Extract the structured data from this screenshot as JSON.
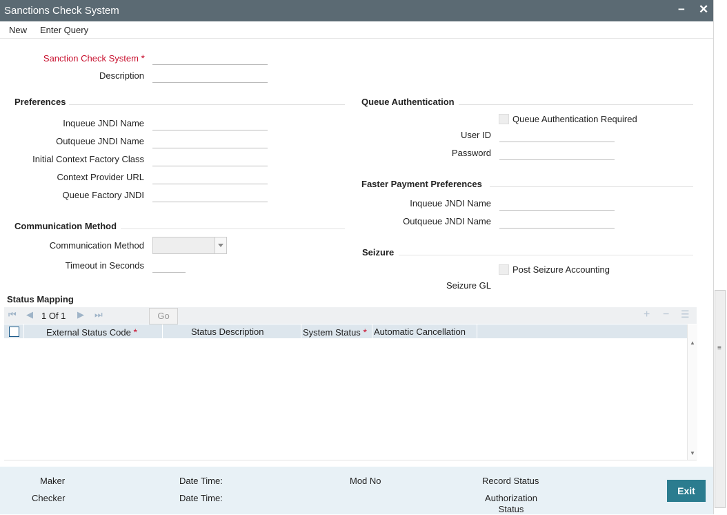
{
  "window": {
    "title": "Sanctions Check System",
    "minimize": "−",
    "close": "✕"
  },
  "menu": {
    "new": "New",
    "enter_query": "Enter Query"
  },
  "main": {
    "sanction_check_system": "Sanction Check System",
    "required_mark": "*",
    "description": "Description"
  },
  "preferences": {
    "title": "Preferences",
    "inqueue_jndi_name": "Inqueue JNDI Name",
    "outqueue_jndi_name": "Outqueue JNDI Name",
    "initial_context_factory_class": "Initial Context Factory Class",
    "context_provider_url": "Context Provider URL",
    "queue_factory_jndi": "Queue Factory JNDI"
  },
  "communication": {
    "title": "Communication Method",
    "method_label": "Communication Method",
    "timeout_label": "Timeout in Seconds"
  },
  "queue_auth": {
    "title": "Queue Authentication",
    "required_label": "Queue Authentication Required",
    "user_id": "User ID",
    "password": "Password"
  },
  "faster_payment": {
    "title": "Faster Payment Preferences",
    "inqueue_jndi_name": "Inqueue JNDI Name",
    "outqueue_jndi_name": "Outqueue JNDI Name"
  },
  "seizure": {
    "title": "Seizure",
    "post_label": "Post Seizure Accounting",
    "gl_label": "Seizure GL"
  },
  "status_mapping": {
    "title": "Status Mapping",
    "pager": "1 Of 1",
    "go": "Go",
    "columns": [
      "External Status Code",
      "Status Description",
      "System Status",
      "Automatic Cancellation"
    ],
    "required_mark": "*"
  },
  "footer": {
    "maker": "Maker",
    "checker": "Checker",
    "date_time_1": "Date Time:",
    "date_time_2": "Date Time:",
    "mod_no": "Mod No",
    "record_status": "Record Status",
    "authorization_status": "Authorization Status",
    "exit": "Exit"
  },
  "colors": {
    "titlebar": "#5b6a73",
    "required": "#c8102e",
    "exit_button": "#2b7c8f",
    "footer": "#e8f1f6",
    "grid_header": "#dde6ed"
  }
}
